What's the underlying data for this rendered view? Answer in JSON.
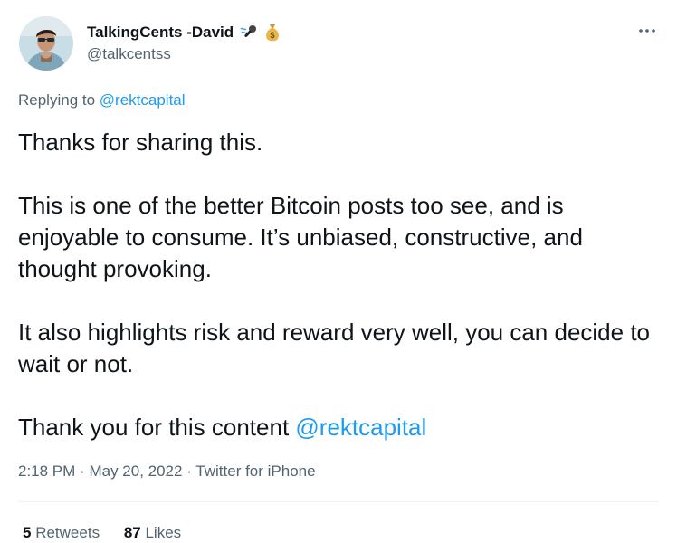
{
  "author": {
    "name": "TalkingCents -David",
    "handle": "@talkcentss",
    "name_emojis": [
      "microphone-icon",
      "money-bag-icon"
    ]
  },
  "reply_context": {
    "prefix": "Replying to",
    "mention": "@rektcapital"
  },
  "tweet": {
    "paragraphs": [
      "Thanks for sharing this.",
      "This is one of the better Bitcoin posts too see, and is enjoyable to consume. It’s unbiased, constructive, and thought provoking.",
      "It also highlights risk and reward very well, you can decide to wait or not."
    ],
    "closing": "Thank you for this content",
    "closing_mention": "@rektcapital"
  },
  "meta": {
    "time": "2:18 PM",
    "separator": "·",
    "date": "May 20, 2022",
    "source": "Twitter for iPhone"
  },
  "stats": {
    "retweets_count": "5",
    "retweets_label": "Retweets",
    "likes_count": "87",
    "likes_label": "Likes"
  },
  "colors": {
    "link": "#1d9bf0",
    "secondary_text": "#536471",
    "primary_text": "#0f1419",
    "divider": "#eff3f4"
  },
  "icons": {
    "more": "more-horizontal-icon",
    "avatar": "user-avatar"
  }
}
